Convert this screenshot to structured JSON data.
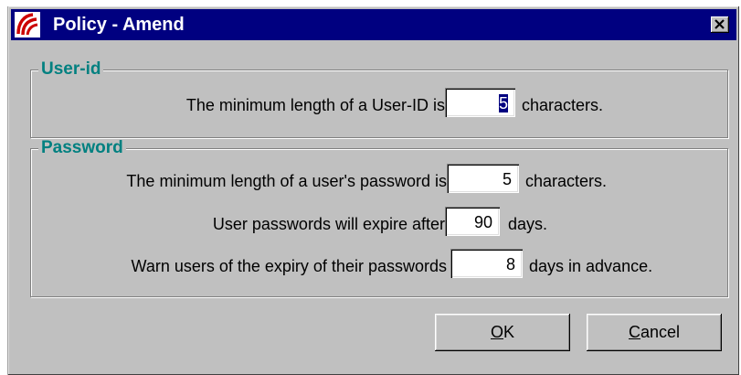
{
  "window": {
    "title": "Policy - Amend"
  },
  "userid_group": {
    "legend": "User-id",
    "min_length_label": "The minimum length of a User-ID is",
    "min_length_value": "5",
    "min_length_unit": "characters."
  },
  "password_group": {
    "legend": "Password",
    "min_length_label": "The minimum length of a user's password is",
    "min_length_value": "5",
    "min_length_unit": "characters.",
    "expire_label": "User passwords will expire after",
    "expire_value": "90",
    "expire_unit": "days.",
    "warn_label": "Warn users of the expiry of their passwords",
    "warn_value": "8",
    "warn_unit": "days in advance."
  },
  "buttons": {
    "ok_mnemonic": "O",
    "ok_rest": "K",
    "cancel_mnemonic": "C",
    "cancel_rest": "ancel"
  },
  "icons": {
    "app": "app-logo-icon",
    "close": "close-icon"
  },
  "colors": {
    "titlebar": "#000080",
    "group_legend": "#008080",
    "window_face": "#c0c0c0"
  }
}
